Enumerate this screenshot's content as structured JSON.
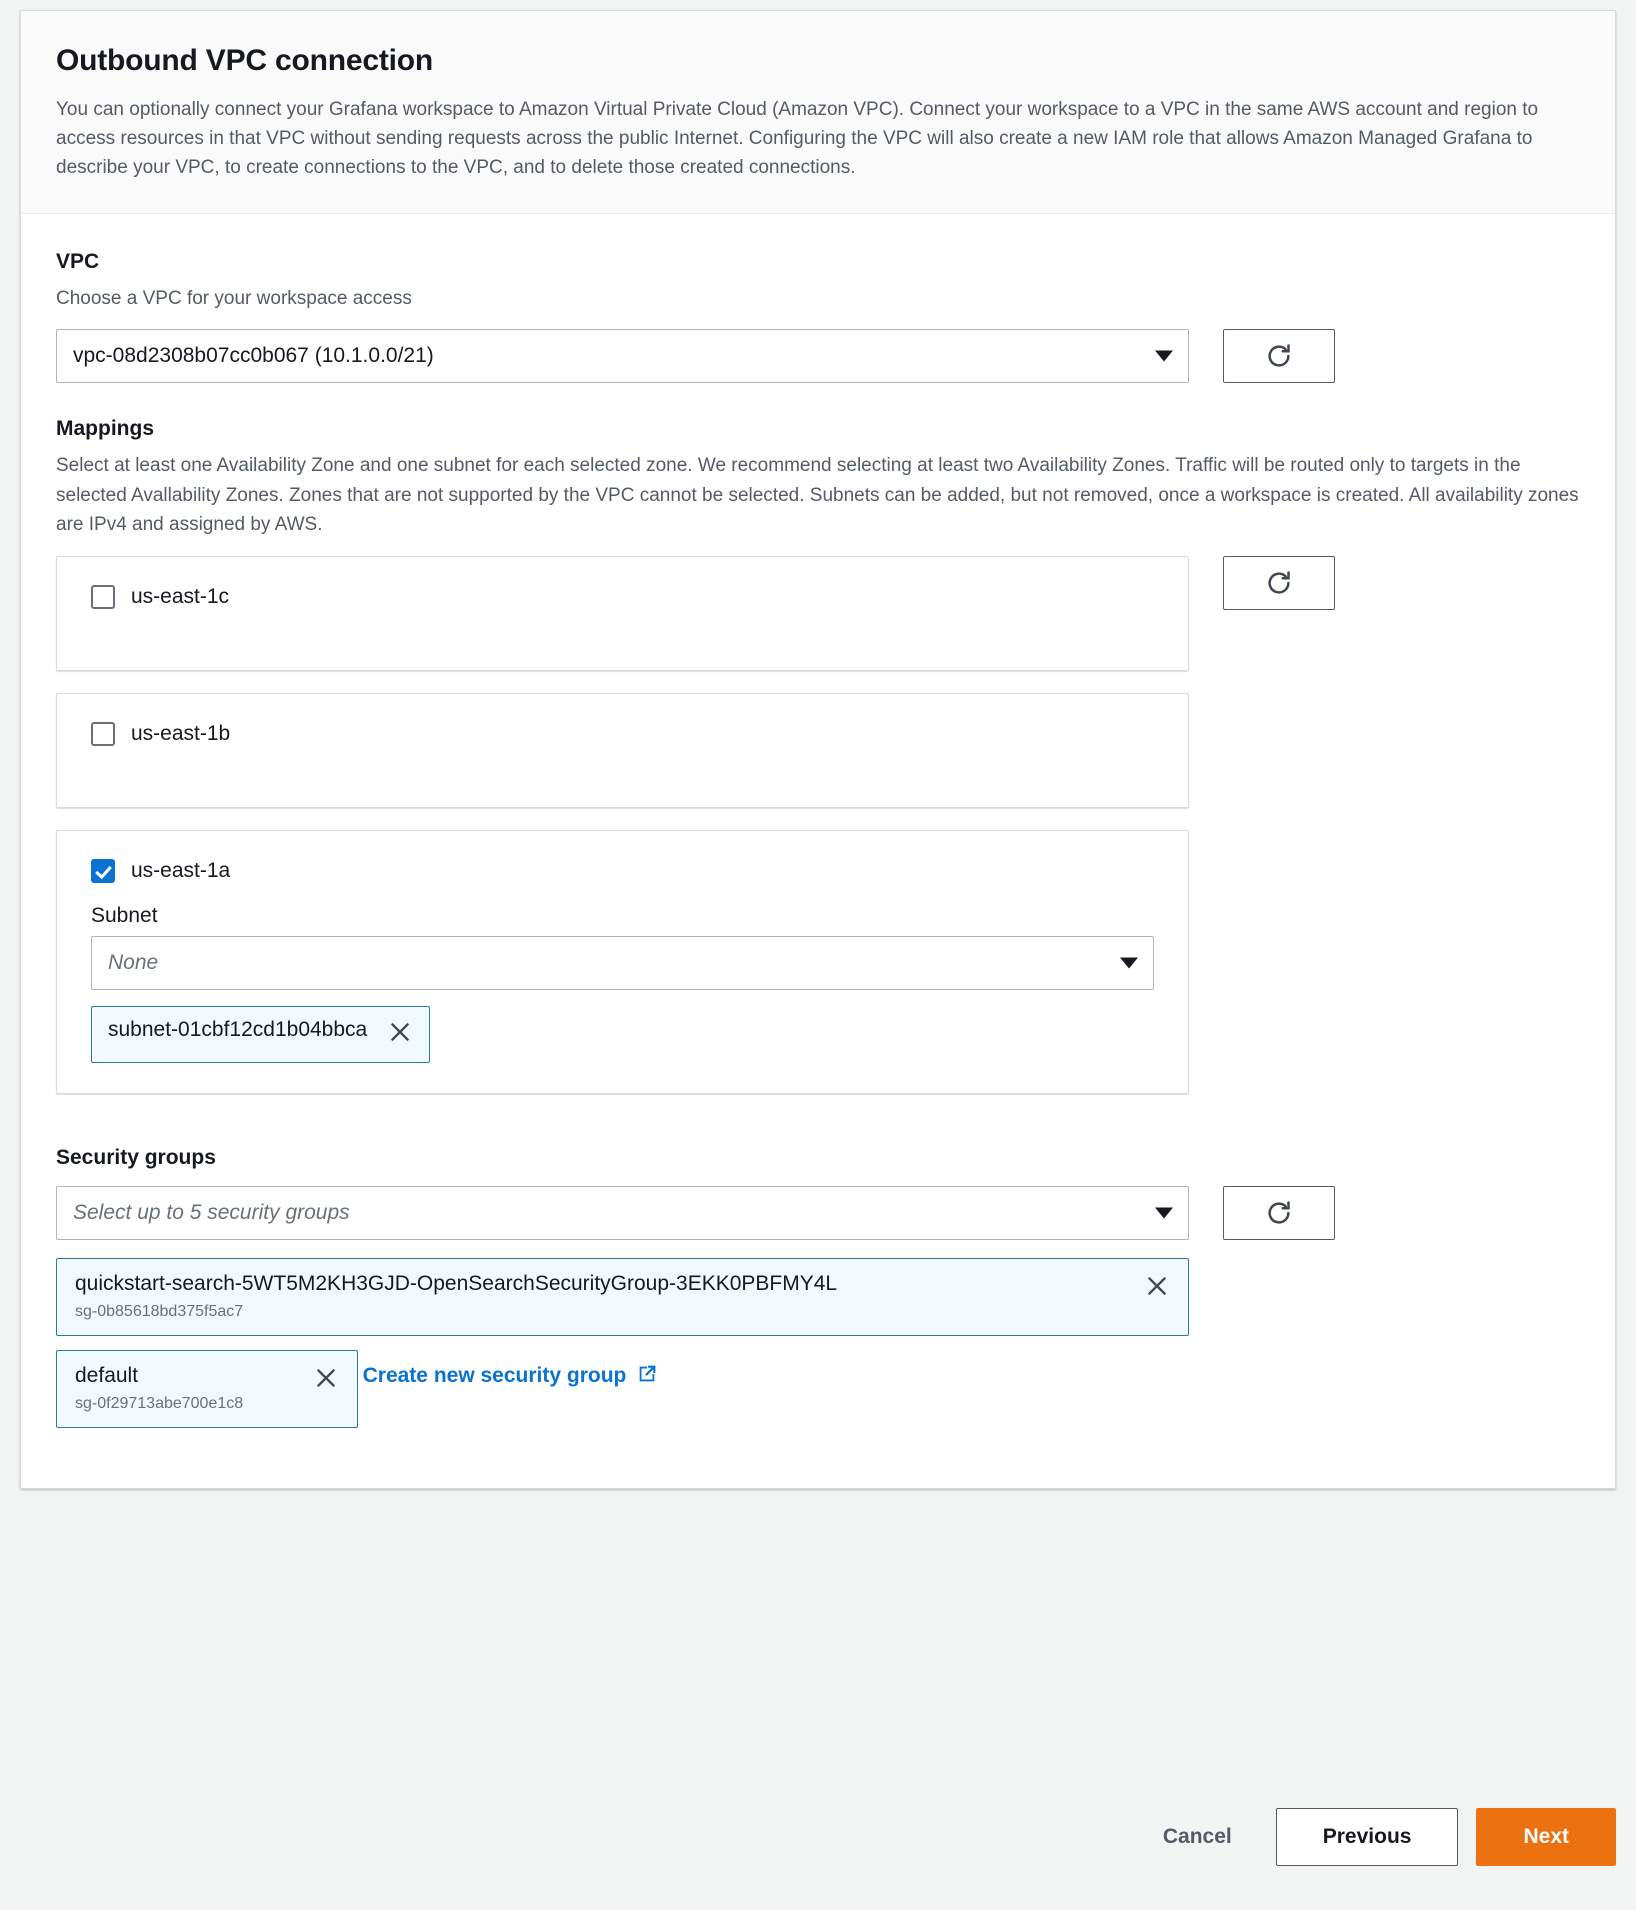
{
  "header": {
    "title": "Outbound VPC connection",
    "description": "You can optionally connect your Grafana workspace to Amazon Virtual Private Cloud (Amazon VPC). Connect your workspace to a VPC in the same AWS account and region to access resources in that VPC without sending requests across the public Internet. Configuring the VPC will also create a new IAM role that allows Amazon Managed Grafana to describe your VPC, to create connections to the VPC, and to delete those created connections."
  },
  "vpc": {
    "title": "VPC",
    "subtitle": "Choose a VPC for your workspace access",
    "selected": "vpc-08d2308b07cc0b067 (10.1.0.0/21)",
    "refresh_icon": "refresh-icon",
    "caret_icon": "chevron-down-icon"
  },
  "mappings": {
    "title": "Mappings",
    "description": "Select at least one Availability Zone and one subnet for each selected zone. We recommend selecting at least two Availability Zones. Traffic will be routed only to targets in the selected Avallability Zones. Zones that are not supported by the VPC cannot be selected. Subnets can be added, but not removed, once a workspace is created. All availability zones are IPv4 and assigned by AWS.",
    "zones": [
      {
        "label": "us-east-1c",
        "checked": false
      },
      {
        "label": "us-east-1b",
        "checked": false
      },
      {
        "label": "us-east-1a",
        "checked": true,
        "subnet_label": "Subnet",
        "subnet_placeholder": "None",
        "subnet_chips": [
          {
            "label": "subnet-01cbf12cd1b04bbca",
            "remove_icon": "close-icon"
          }
        ]
      }
    ]
  },
  "security_groups": {
    "title": "Security groups",
    "placeholder": "Select up to 5 security groups",
    "chips": [
      {
        "label": "quickstart-search-5WT5M2KH3GJD-OpenSearchSecurityGroup-3EKK0PBFMY4L",
        "id": "sg-0b85618bd375f5ac7",
        "remove_icon": "close-icon"
      },
      {
        "label": "default",
        "id": "sg-0f29713abe700e1c8",
        "remove_icon": "close-icon"
      }
    ],
    "create_link": "Create new security group",
    "create_link_icon": "external-link-icon"
  },
  "footer": {
    "cancel": "Cancel",
    "previous": "Previous",
    "next": "Next"
  },
  "colors": {
    "accent_blue": "#0972d3",
    "chip_border": "#2b7c99",
    "chip_bg": "#f1faff",
    "next_orange": "#ec7211",
    "page_bg": "#f2f3f3"
  }
}
